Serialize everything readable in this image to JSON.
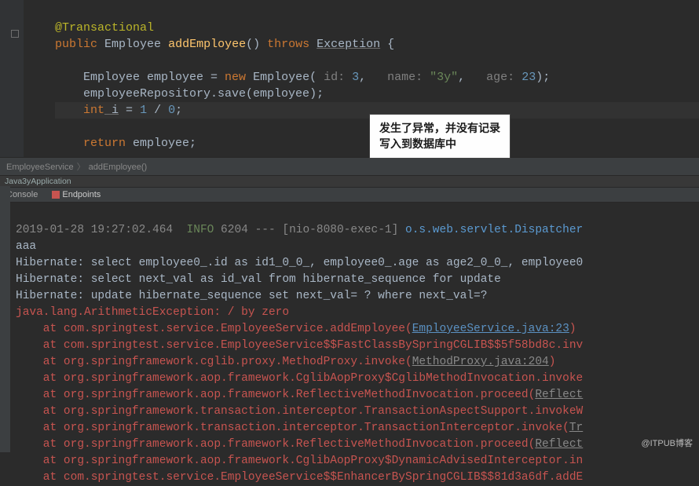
{
  "code": {
    "annotation": "@Transactional",
    "kw_public": "public",
    "type_employee": "Employee",
    "method_name": "addEmployee",
    "kw_throws": "throws",
    "type_exception": "Exception",
    "line2_var": "Employee employee = ",
    "kw_new": "new",
    "ctor": " Employee(",
    "p_id": " id:",
    "v_id": " 3",
    "p_name": "   name:",
    "v_name": " \"3y\"",
    "p_age": "   age:",
    "v_age": " 23",
    "paren_end": ");",
    "line3": "employeeRepository.save(employee);",
    "kw_int": "int",
    "var_i": " i",
    "assign": " = ",
    "expr_1": "1",
    "expr_slash": " / ",
    "expr_0": "0",
    "semi": ";",
    "kw_return": "return",
    "ret_expr": " employee;"
  },
  "tooltip": {
    "line1": "发生了异常，并没有记录",
    "line2": "写入到数据库中"
  },
  "breadcrumb": {
    "a": "EmployeeService",
    "b": "addEmployee()"
  },
  "tabline": "Java3yApplication",
  "tabs": {
    "console": "Console",
    "endpoints": "Endpoints"
  },
  "console": {
    "ts": "2019-01-28 19:27:02.464",
    "level": "  INFO",
    "pid": " 6204 --- [nio-8080-exec-1] ",
    "logger": "o.s.web.servlet.Dispatcher",
    "l2": "aaa",
    "l3": "Hibernate: select employee0_.id as id1_0_0_, employee0_.age as age2_0_0_, employee0",
    "l4": "Hibernate: select next_val as id_val from hibernate_sequence for update",
    "l5": "Hibernate: update hibernate_sequence set next_val= ? where next_val=?",
    "exc": "java.lang.ArithmeticException: / by zero",
    "at": "    at ",
    "s1a": "com.springtest.service.EmployeeService.addEmployee(",
    "s1b": "EmployeeService.java:23",
    "s2a": "com.springtest.service.EmployeeService$$FastClassBySpringCGLIB$$5f58bd8c.inv",
    "s3a": "org.springframework.cglib.proxy.MethodProxy.invoke(",
    "s3b": "MethodProxy.java:204",
    "s4a": "org.springframework.aop.framework.CglibAopProxy$CglibMethodInvocation.invoke",
    "s5a": "org.springframework.aop.framework.ReflectiveMethodInvocation.proceed(",
    "s5b": "Reflect",
    "s6a": "org.springframework.transaction.interceptor.TransactionAspectSupport.invokeW",
    "s7a": "org.springframework.transaction.interceptor.TransactionInterceptor.invoke(",
    "s7b": "Tr",
    "s8a": "org.springframework.aop.framework.ReflectiveMethodInvocation.proceed(",
    "s8b": "Reflect",
    "s9a": "org.springframework.aop.framework.CglibAopProxy$DynamicAdvisedInterceptor.in",
    "s10a": "com.springtest.service.EmployeeService$$EnhancerBySpringCGLIB$$81d3a6df.addE"
  },
  "watermark": "@ITPUB博客"
}
